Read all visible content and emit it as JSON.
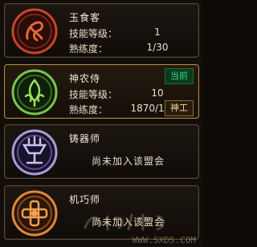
{
  "professions": [
    {
      "name": "玉食客",
      "skill_level_label": "技能等级：",
      "skill_level": "1",
      "proficiency_label": "熟练度：",
      "proficiency": "1/30"
    },
    {
      "name": "神农侍",
      "current_label": "当前",
      "skill_level_label": "技能等级：",
      "skill_level": "10",
      "proficiency_label": "熟练度：",
      "proficiency": "1870/1870",
      "title_badge": "神工"
    },
    {
      "name": "铸器师",
      "status": "尚未加入该盟会"
    },
    {
      "name": "机巧师",
      "status": "尚未加入该盟会"
    }
  ],
  "watermark": "WWW.SXDS.COM",
  "colors": {
    "accent_border": "#b38a3c",
    "current_green": "#33e07a",
    "emblem_red": "#c8452a",
    "emblem_green": "#7bc34a",
    "emblem_purple": "#a99bd8",
    "emblem_orange": "#e0883a"
  },
  "icons": [
    "yushike-emblem-icon",
    "shennongshi-emblem-icon",
    "zhuqishi-emblem-icon",
    "jiqiaoshi-emblem-icon"
  ]
}
